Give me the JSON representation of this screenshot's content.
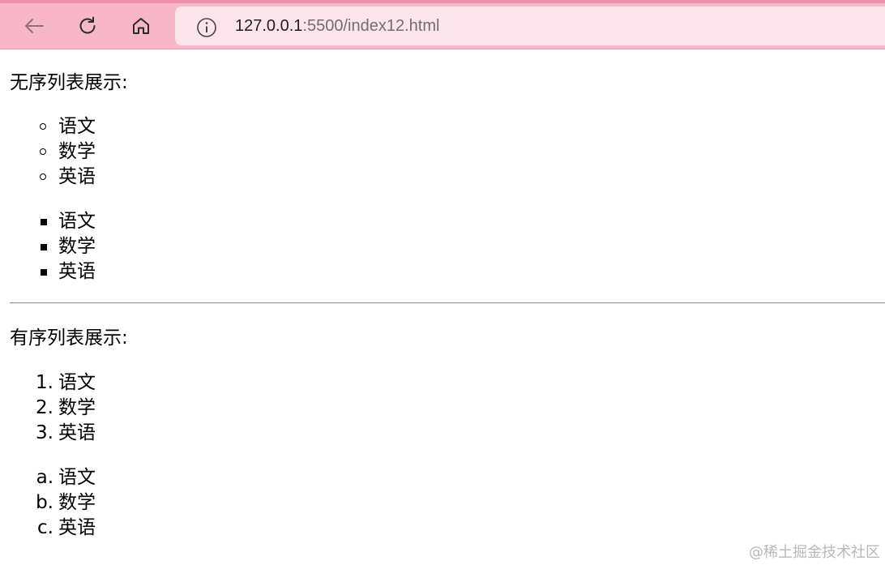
{
  "browser": {
    "url_host": "127.0.0.1",
    "url_rest": ":5500/index12.html",
    "icons": [
      "back-arrow-icon",
      "reload-icon",
      "home-icon",
      "info-icon"
    ]
  },
  "page": {
    "unordered_heading": "无序列表展示:",
    "unordered_circle": [
      "语文",
      "数学",
      "英语"
    ],
    "unordered_square": [
      "语文",
      "数学",
      "英语"
    ],
    "ordered_heading": "有序列表展示:",
    "ordered_numeric": {
      "markers": [
        "1.",
        "2.",
        "3."
      ],
      "items": [
        "语文",
        "数学",
        "英语"
      ]
    },
    "ordered_alpha": {
      "markers": [
        "a.",
        "b.",
        "c."
      ],
      "items": [
        "语文",
        "数学",
        "英语"
      ]
    }
  },
  "watermark": "@稀土掘金技术社区",
  "colors": {
    "toolbar": "#f7b7c9",
    "address_bar": "#fde3ec"
  }
}
